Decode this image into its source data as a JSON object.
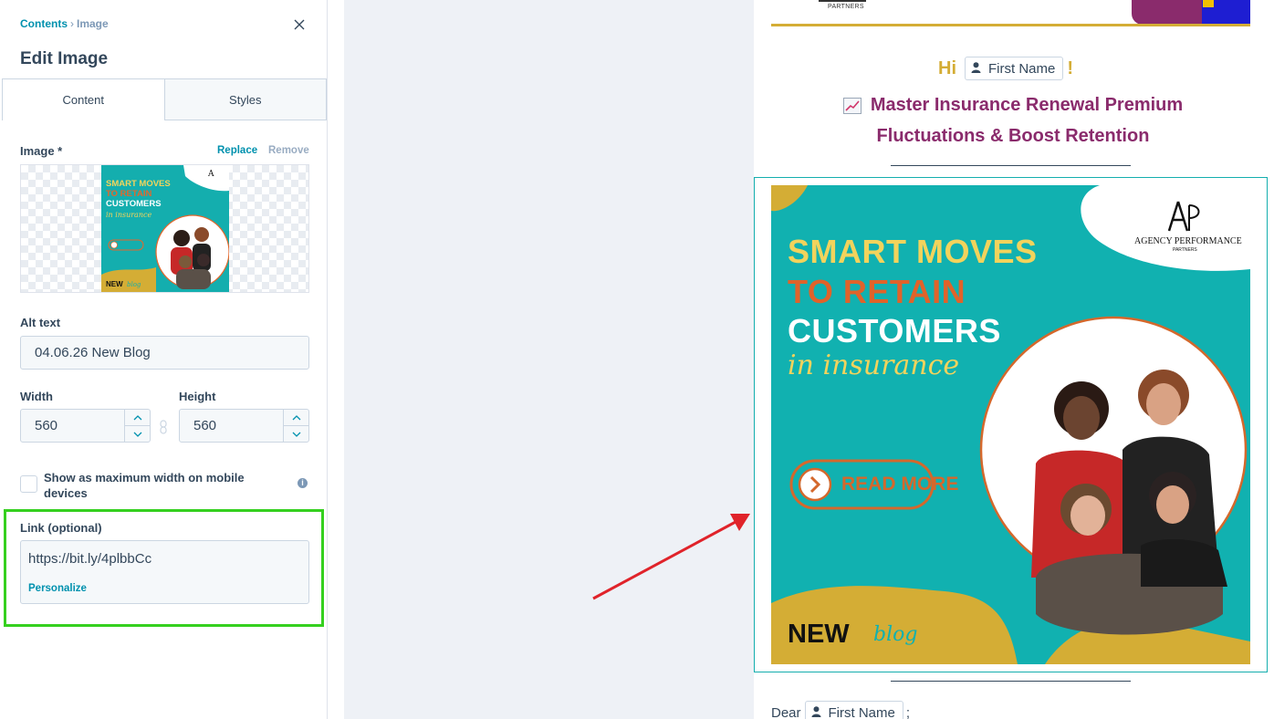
{
  "panel": {
    "breadcrumb": {
      "root": "Contents",
      "separator": "›",
      "current": "Image"
    },
    "title": "Edit Image",
    "tabs": [
      {
        "label": "Content",
        "active": true
      },
      {
        "label": "Styles",
        "active": false
      }
    ],
    "image": {
      "label": "Image *",
      "replace": "Replace",
      "remove": "Remove"
    },
    "alt_text": {
      "label": "Alt text",
      "value": "04.06.26 New Blog"
    },
    "width": {
      "label": "Width",
      "value": "560"
    },
    "height": {
      "label": "Height",
      "value": "560"
    },
    "mobile_checkbox": {
      "label": "Show as maximum width on mobile devices",
      "checked": false
    },
    "link": {
      "label": "Link (optional)",
      "value": "https://bit.ly/4plbbCc",
      "personalize": "Personalize"
    }
  },
  "email": {
    "header_partners": "PARTNERS",
    "greeting": {
      "hi": "Hi",
      "token": "First Name",
      "punct": "!"
    },
    "headline": "Master Insurance Renewal Premium Fluctuations & Boost Retention",
    "banner": {
      "line1": "SMART MOVES",
      "line2": "TO RETAIN",
      "line3": "CUSTOMERS",
      "script": "in insurance",
      "cta": "READ MORE",
      "new": "NEW",
      "blog": "blog",
      "logo_main": "AGENCY PERFORMANCE",
      "logo_sub": "PARTNERS",
      "logo_mark": "AP"
    },
    "dear": {
      "prefix": "Dear",
      "token": "First Name",
      "suffix": ";"
    }
  },
  "colors": {
    "accent_link": "#0091ae",
    "highlight_box": "#35d01f",
    "arrow": "#e0232a",
    "banner_teal": "#11b1b0",
    "gold": "#d4ad35",
    "plum": "#8a2b6c"
  }
}
